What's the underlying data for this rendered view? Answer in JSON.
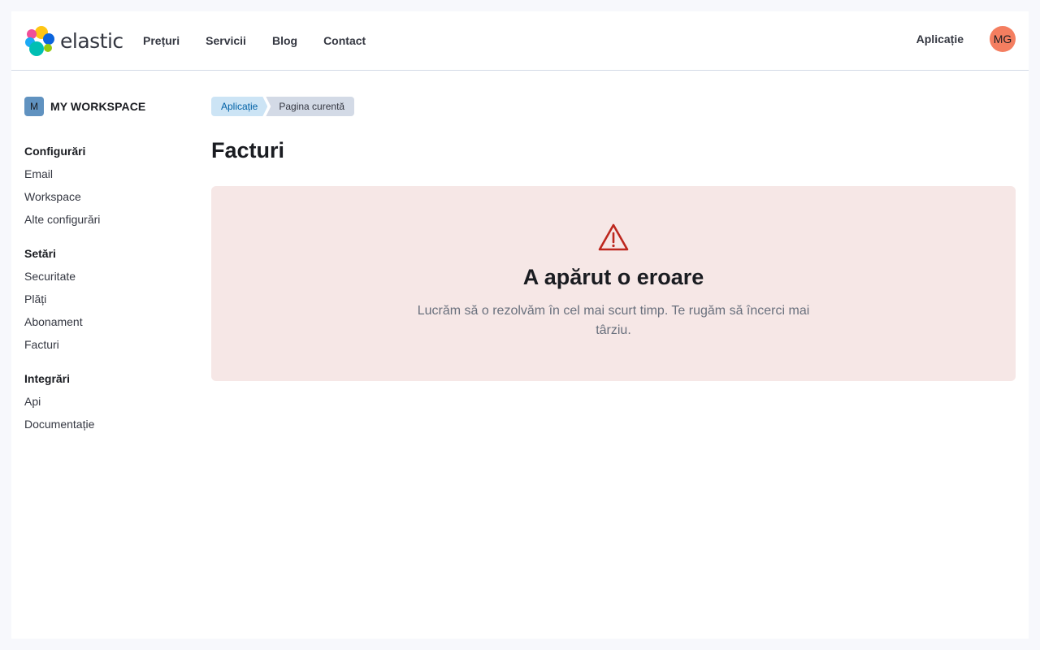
{
  "brand": {
    "name": "elastic"
  },
  "nav": {
    "items": [
      "Prețuri",
      "Servicii",
      "Blog",
      "Contact"
    ]
  },
  "header_right": {
    "app_link": "Aplicație",
    "avatar_initials": "MG",
    "avatar_color": "#f47e60"
  },
  "sidebar": {
    "workspace_badge": "M",
    "workspace_name": "MY WORKSPACE",
    "groups": [
      {
        "title": "Configurări",
        "items": [
          "Email",
          "Workspace",
          "Alte configurări"
        ]
      },
      {
        "title": "Setări",
        "items": [
          "Securitate",
          "Plăți",
          "Abonament",
          "Facturi"
        ]
      },
      {
        "title": "Integrări",
        "items": [
          "Api",
          "Documentație"
        ]
      }
    ]
  },
  "breadcrumbs": [
    "Aplicație",
    "Pagina curentă"
  ],
  "page": {
    "title": "Facturi"
  },
  "error": {
    "icon": "warning-icon",
    "title": "A apărut o eroare",
    "body": "Lucrăm să o rezolvăm în cel mai scurt timp. Te rugăm să încerci mai târziu.",
    "accent_color": "#bd271e",
    "background": "#f6e7e6"
  }
}
